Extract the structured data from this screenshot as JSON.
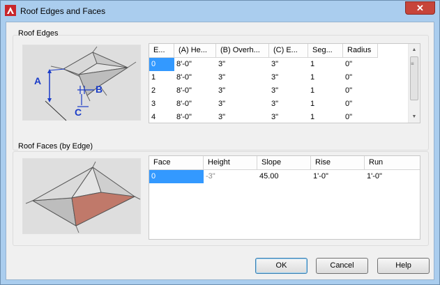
{
  "window": {
    "title": "Roof Edges and Faces",
    "close_glyph": "✕",
    "accent": "#aacdee"
  },
  "edges": {
    "group_label": "Roof Edges",
    "illustration_labels": {
      "a": "A",
      "b": "B",
      "c": "C"
    },
    "columns": [
      "E...",
      "(A) He...",
      "(B) Overh...",
      "(C) E...",
      "Seg...",
      "Radius"
    ],
    "rows": [
      [
        "0",
        "8'-0\"",
        "3\"",
        "3\"",
        "1",
        "0\""
      ],
      [
        "1",
        "8'-0\"",
        "3\"",
        "3\"",
        "1",
        "0\""
      ],
      [
        "2",
        "8'-0\"",
        "3\"",
        "3\"",
        "1",
        "0\""
      ],
      [
        "3",
        "8'-0\"",
        "3\"",
        "3\"",
        "1",
        "0\""
      ],
      [
        "4",
        "8'-0\"",
        "3\"",
        "3\"",
        "1",
        "0\""
      ]
    ],
    "selected_row": 0
  },
  "faces": {
    "group_label": "Roof Faces (by Edge)",
    "columns": [
      "Face",
      "Height",
      "Slope",
      "Rise",
      "Run"
    ],
    "rows": [
      [
        "0",
        "-3\"",
        "45.00",
        "1'-0\"",
        "1'-0\""
      ]
    ],
    "selected_row": 0,
    "highlight_color": "#c0796a"
  },
  "buttons": {
    "ok": "OK",
    "cancel": "Cancel",
    "help": "Help"
  }
}
